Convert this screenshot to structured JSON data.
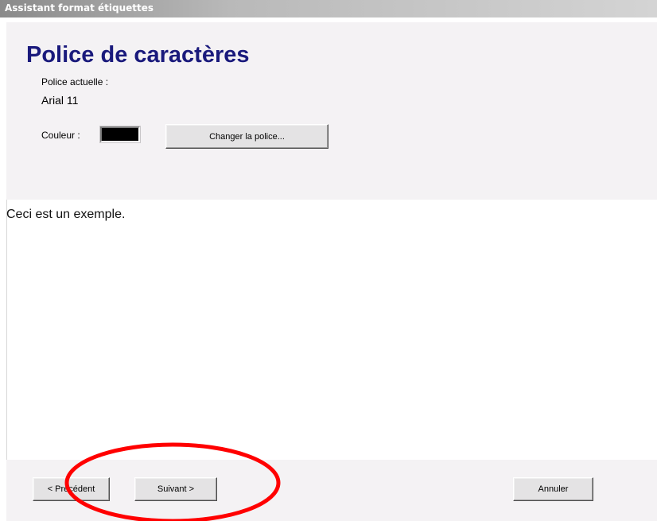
{
  "window": {
    "title": "Assistant format étiquettes"
  },
  "header": {
    "title": "Police de caractères",
    "current_font_label": "Police actuelle :",
    "current_font_value": "Arial 11",
    "color_label": "Couleur :",
    "color_value": "#000000",
    "change_font_button": "Changer la police..."
  },
  "preview": {
    "sample_text": "Ceci est un exemple."
  },
  "footer": {
    "previous_button": "< Précédent",
    "next_button": "Suivant >",
    "cancel_button": "Annuler"
  },
  "annotation": {
    "shape": "ellipse",
    "color": "#ff0000",
    "highlights": "next-button"
  }
}
